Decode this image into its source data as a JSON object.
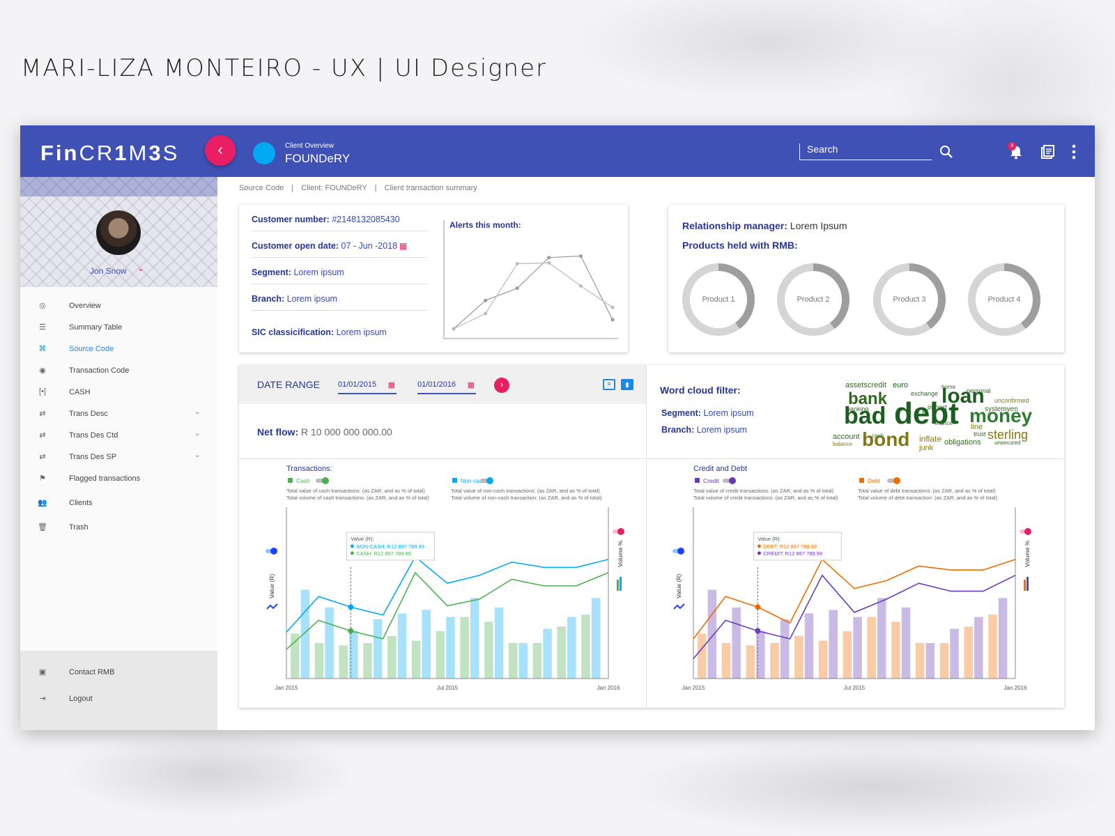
{
  "page_title": "MARI-LIZA MONTEIRO - UX | UI Designer",
  "logo": {
    "part1": "Fin",
    "part2": "CR",
    "part3": "1",
    "part4": "M",
    "part5": "3",
    "part6": "S"
  },
  "header": {
    "client_sub": "Client Overview",
    "client_name": "FOUNDeRY",
    "search_placeholder": "Search",
    "notification_count": "3"
  },
  "user": {
    "name": "Jon Snow"
  },
  "nav": [
    {
      "label": "Overview",
      "icon": "overview-icon"
    },
    {
      "label": "Summary Table",
      "icon": "list-icon"
    },
    {
      "label": "Source Code",
      "icon": "code-icon",
      "active": true
    },
    {
      "label": "Transaction Code",
      "icon": "fingerprint-icon"
    },
    {
      "label": "CASH",
      "icon": "cash-icon"
    },
    {
      "label": "Trans Desc",
      "icon": "transfer-icon",
      "expand": true
    },
    {
      "label": "Trans Des Ctd",
      "icon": "transfer-icon",
      "expand": true
    },
    {
      "label": "Trans Des SP",
      "icon": "transfer-icon",
      "expand": true
    },
    {
      "label": "Flagged transactions",
      "icon": "flag-icon"
    },
    {
      "label": "Clients",
      "icon": "people-icon"
    },
    {
      "label": "Trash",
      "icon": "trash-icon"
    }
  ],
  "footer_nav": [
    {
      "label": "Contact RMB"
    },
    {
      "label": "Logout"
    }
  ],
  "breadcrumb": [
    "Source Code",
    "Client: FOUNDeRY",
    "Client  transaction summary"
  ],
  "customer": {
    "number_label": "Customer number:",
    "number": "#2148132085430",
    "open_label": "Customer open date:",
    "open": "07 - Jun -2018",
    "segment_label": "Segment:",
    "segment": "Lorem ipsum",
    "branch_label": "Branch:",
    "branch": "Lorem ipsum",
    "sic_label": "SIC classicification:",
    "sic": "Lorem ipsum"
  },
  "alerts": {
    "title": "Alerts this month:"
  },
  "relationship": {
    "manager_label": "Relationship manager:",
    "manager": "Lorem Ipsum",
    "products_label": "Products held with RMB:",
    "products": [
      "Product 1",
      "Product 2",
      "Product 3",
      "Product 4"
    ]
  },
  "daterange": {
    "label": "DATE RANGE",
    "from": "01/01/2015",
    "to": "01/01/2016"
  },
  "netflow": {
    "label": "Net flow:",
    "value": "R 10 000 000 000.00"
  },
  "wordcloud": {
    "title": "Word cloud filter:",
    "segment_label": "Segment:",
    "segment": "Lorem ipsum",
    "branch_label": "Branch:",
    "branch": "Lorem ipsum",
    "words": [
      "bad",
      "debt",
      "bank",
      "loan",
      "money",
      "bond",
      "sterling",
      "assets",
      "credit",
      "euro",
      "exchange",
      "import",
      "fx",
      "inflate",
      "junk",
      "obligations",
      "line",
      "trust",
      "account",
      "balance",
      "banking",
      "cash",
      "financial",
      "finance",
      "personal",
      "unconfirmed",
      "systemyen",
      "unsecured",
      "home"
    ]
  },
  "transactions": {
    "title": "Transactions:",
    "legend": [
      {
        "name": "Cash",
        "color": "#4caf50",
        "desc1": "Total value of cash transactions: (as ZAR, and as % of total)",
        "desc2": "Total volume of cash transactions: (as ZAR, and as % of total)"
      },
      {
        "name": "Non-cash",
        "color": "#03a9f4",
        "desc1": "Total value of non-cash transactions: (as ZAR, and as % of total)",
        "desc2": "Total volume of non-cash transaction: (as ZAR, and as % of total)"
      }
    ],
    "tooltip": {
      "title": "Value (R):",
      "line1": "NON-CASH: R12 897 789.99",
      "line2": "CASH: R12 897 789.99"
    },
    "ylabel": "Value (R)",
    "y2label": "Volume %",
    "ticks": [
      "Jan 2015",
      "Jul 2015",
      "Jan 2016"
    ]
  },
  "creditdebt": {
    "title": "Credit and Debt",
    "legend": [
      {
        "name": "Credit",
        "color": "#673ab7",
        "desc1": "Total value of credit transactions: (as ZAR, and as % of total)",
        "desc2": "Total volume of credit transactions: (as ZAR, and as % of total)"
      },
      {
        "name": "Debt",
        "color": "#ef6c00",
        "desc1": "Total value of debt transactions: (as ZAR, and as % of total)",
        "desc2": "Total volume of debt  transaction: (as ZAR, and as % of total)"
      }
    ],
    "tooltip": {
      "title": "Value (R):",
      "line1": "DEBT: R12 897 789.99",
      "line2": "CREDIT: R12 897 789.99"
    },
    "ylabel": "Value (R)",
    "y2label": "Volume %",
    "ticks": [
      "Jan 2015",
      "Jul 2015",
      "Jan 2016"
    ]
  },
  "chart_data": [
    {
      "type": "line",
      "title": "Alerts this month:",
      "series": [
        {
          "values": [
            0,
            37,
            53,
            93,
            95,
            12
          ]
        },
        {
          "values": [
            0,
            20,
            85,
            86,
            56,
            28
          ]
        }
      ]
    },
    {
      "type": "line+bar",
      "title": "Transactions:",
      "x_ticks": [
        "Jan 2015",
        "Jul 2015",
        "Jan 2016"
      ],
      "series": [
        {
          "name": "Non-cash",
          "kind": "line",
          "values": [
            35,
            62,
            54,
            48,
            92,
            72,
            78,
            88,
            84,
            84,
            90
          ]
        },
        {
          "name": "Cash",
          "kind": "line",
          "values": [
            22,
            44,
            36,
            30,
            80,
            55,
            60,
            75,
            70,
            70,
            80
          ]
        },
        {
          "name": "Cash",
          "kind": "bar",
          "values": [
            38,
            26,
            30,
            30,
            28,
            26,
            30,
            40,
            36,
            28,
            32,
            30,
            40,
            50,
            52,
            40,
            48,
            44,
            30,
            36,
            30,
            42,
            44,
            52,
            54
          ]
        },
        {
          "name": "Non-cash",
          "kind": "bar",
          "values": [
            75,
            68,
            60,
            62,
            40,
            54,
            50,
            58,
            55,
            60,
            58,
            52,
            52,
            70,
            68,
            48,
            60,
            58,
            30,
            52,
            42,
            38,
            52,
            66,
            68
          ]
        }
      ]
    },
    {
      "type": "line+bar",
      "title": "Credit and Debt",
      "x_ticks": [
        "Jan 2015",
        "Jul 2015",
        "Jan 2016"
      ],
      "series": [
        {
          "name": "Debt",
          "kind": "line",
          "values": [
            30,
            62,
            54,
            42,
            90,
            68,
            74,
            85,
            82,
            82,
            90
          ]
        },
        {
          "name": "Credit",
          "kind": "line",
          "values": [
            15,
            44,
            36,
            30,
            78,
            50,
            60,
            72,
            66,
            66,
            78
          ]
        },
        {
          "name": "Debt",
          "kind": "bar",
          "values": [
            38,
            26,
            30,
            30,
            28,
            26,
            30,
            40,
            36,
            28,
            32,
            30,
            40,
            50,
            52,
            40,
            48,
            44,
            30,
            36,
            30,
            42,
            44,
            52,
            54
          ]
        },
        {
          "name": "Credit",
          "kind": "bar",
          "values": [
            75,
            68,
            60,
            62,
            40,
            54,
            50,
            58,
            55,
            60,
            58,
            52,
            52,
            70,
            68,
            48,
            60,
            58,
            30,
            52,
            42,
            38,
            52,
            66,
            68
          ]
        }
      ]
    }
  ]
}
